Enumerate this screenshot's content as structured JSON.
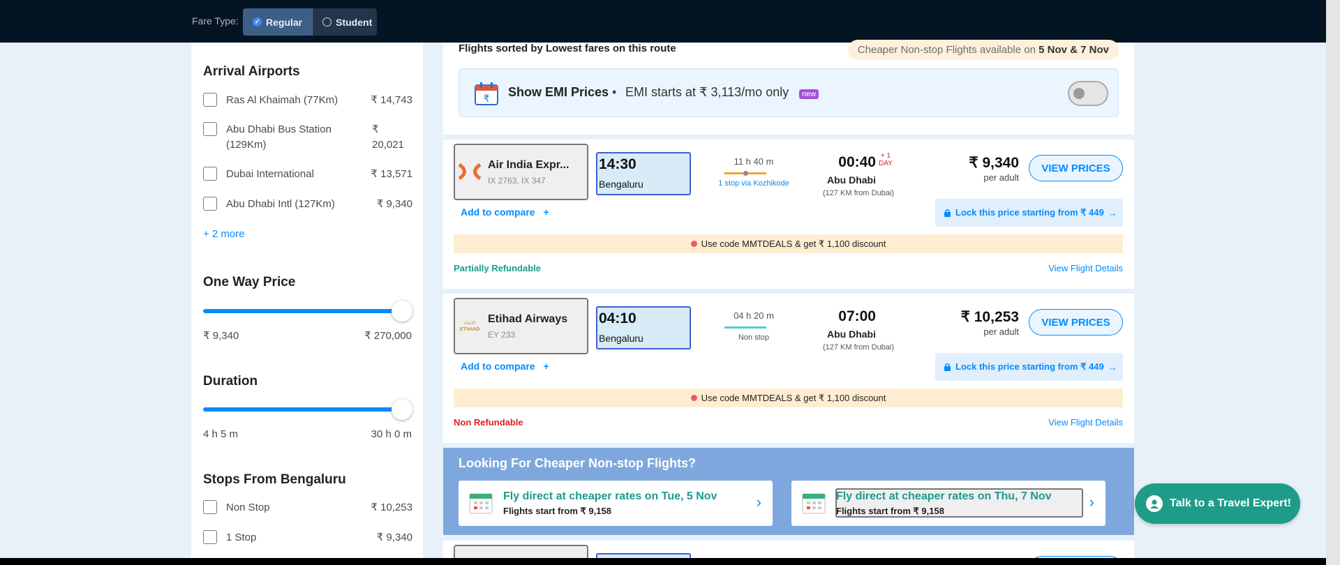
{
  "topbar": {
    "fare_type_label": "Fare Type:",
    "options": [
      {
        "label": "Regular",
        "selected": true
      },
      {
        "label": "Student",
        "selected": false
      }
    ]
  },
  "sidebar": {
    "arrival_airports": {
      "title": "Arrival Airports",
      "items": [
        {
          "label": "Ras Al Khaimah (77Km)",
          "price": "₹ 14,743"
        },
        {
          "label": "Abu Dhabi Bus Station (129Km)",
          "price": "₹ 20,021"
        },
        {
          "label": "Dubai International",
          "price": "₹ 13,571"
        },
        {
          "label": "Abu Dhabi Intl (127Km)",
          "price": "₹ 9,340"
        }
      ],
      "more": "+ 2 more"
    },
    "one_way_price": {
      "title": "One Way Price",
      "min": "₹ 9,340",
      "max": "₹ 270,000",
      "level": 1.0
    },
    "duration": {
      "title": "Duration",
      "min": "4 h 5 m",
      "max": "30 h 0 m",
      "level": 1.0
    },
    "stops": {
      "title": "Stops From Bengaluru",
      "items": [
        {
          "label": "Non Stop",
          "price": "₹ 10,253"
        },
        {
          "label": "1 Stop",
          "price": "₹ 9,340"
        }
      ]
    }
  },
  "main": {
    "sort_text": "Flights sorted by Lowest fares on this route",
    "cheaper_pill_prefix": "Cheaper Non-stop Flights available on ",
    "cheaper_pill_dates": "5 Nov & 7 Nov",
    "emi": {
      "title": "Show EMI Prices",
      "dot": "•",
      "subtitle": "EMI starts at ₹ 3,113/mo only",
      "badge": "new"
    },
    "flights": [
      {
        "airline": "Air India Expr...",
        "codes": "IX 2763, IX 347",
        "dep_time": "14:30",
        "dep_city": "Bengaluru",
        "duration": "11 h 40 m",
        "stops": "1 stop via Kozhikode",
        "arr_time": "00:40",
        "arr_plus": "+ 1",
        "arr_plus_day": "DAY",
        "arr_city": "Abu Dhabi",
        "arr_dist": "(127 KM from Dubai)",
        "price": "₹ 9,340",
        "per_adult": "per adult",
        "view_btn": "VIEW PRICES",
        "lock": "Lock this price starting from ₹ 449",
        "lock_arrow": "→",
        "compare": "Add to compare",
        "compare_plus": "+",
        "promo": "Use code MMTDEALS & get ₹ 1,100 discount",
        "refund": "Partially Refundable",
        "refund_color": "#1a9a8e",
        "details": "View Flight Details"
      },
      {
        "airline": "Etihad Airways",
        "codes": "EY 233",
        "dep_time": "04:10",
        "dep_city": "Bengaluru",
        "duration": "04 h 20 m",
        "stops": "Non stop",
        "arr_time": "07:00",
        "arr_city": "Abu Dhabi",
        "arr_dist": "(127 KM from Dubai)",
        "price": "₹ 10,253",
        "per_adult": "per adult",
        "view_btn": "VIEW PRICES",
        "lock": "Lock this price starting from ₹ 449",
        "lock_arrow": "→",
        "compare": "Add to compare",
        "compare_plus": "+",
        "promo": "Use code MMTDEALS & get ₹ 1,100 discount",
        "refund": "Non Refundable",
        "refund_color": "#e02020",
        "details": "View Flight Details"
      }
    ],
    "cheaper_banner": {
      "title": "Looking For Cheaper Non-stop Flights?",
      "cards": [
        {
          "title": "Fly direct at cheaper rates on Tue, 5 Nov",
          "sub": "Flights start from ₹ 9,158"
        },
        {
          "title": "Fly direct at cheaper rates on Thu, 7 Nov",
          "sub": "Flights start from ₹ 9,158"
        }
      ]
    }
  },
  "talk_button": "Talk to a Travel Expert!",
  "colors": {
    "accent": "#008cff",
    "topbar": "#051423",
    "teal": "#1a9a8e",
    "promo_bg": "#feedd1"
  }
}
